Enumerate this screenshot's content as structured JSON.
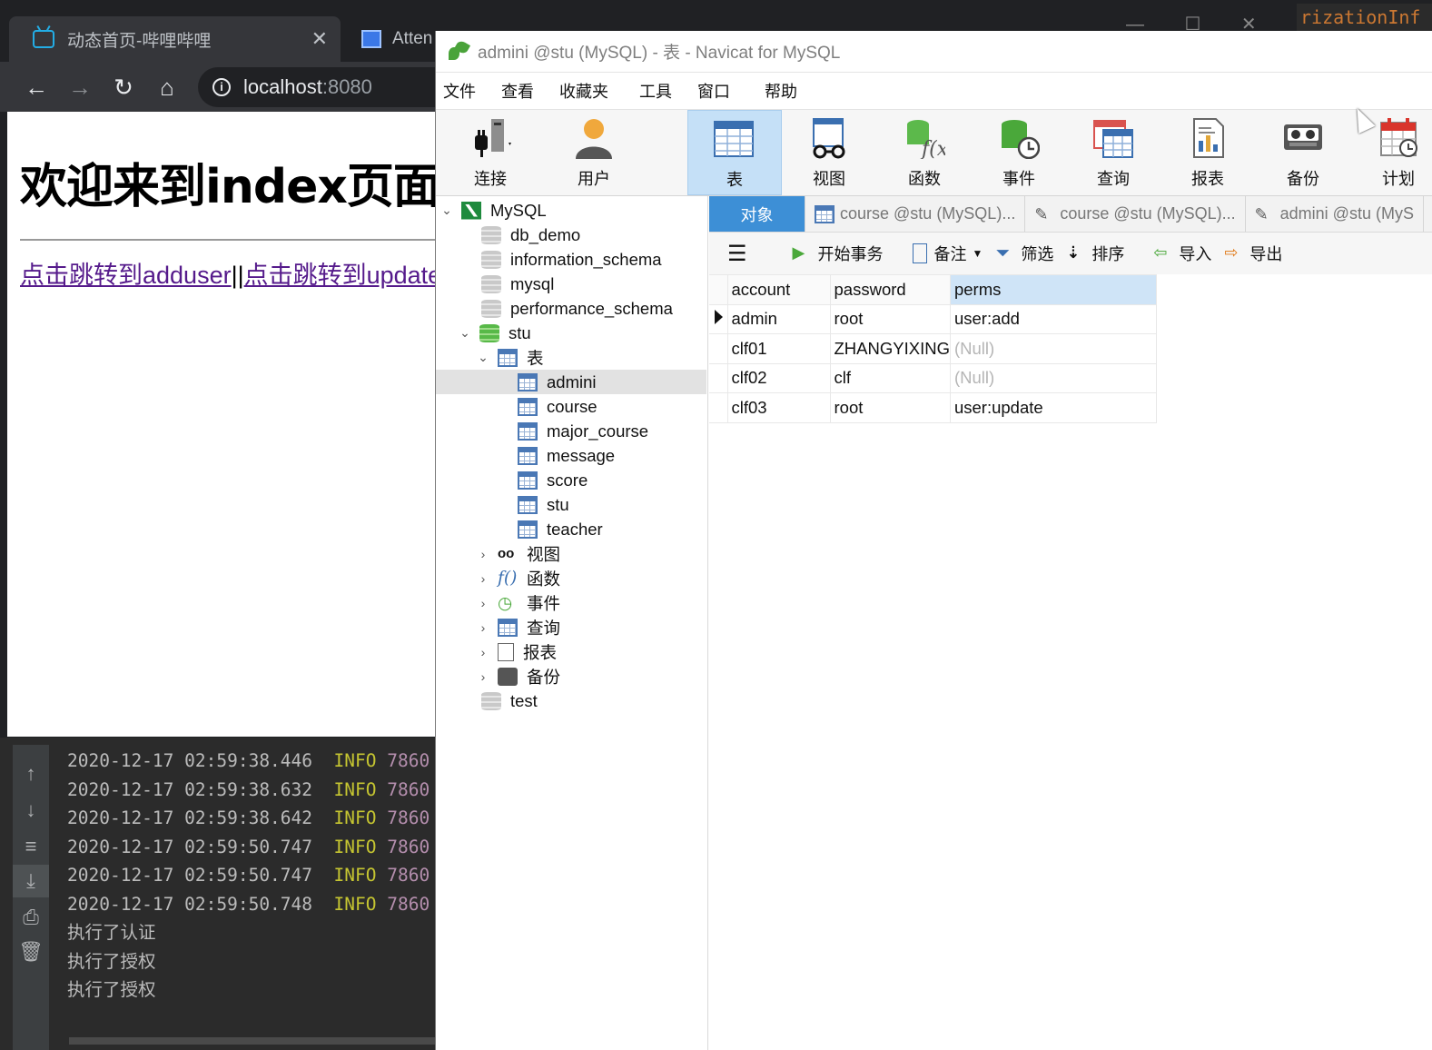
{
  "browser": {
    "tabs": [
      {
        "title": "动态首页-哔哩哔哩",
        "icon": "bilibili-tv-icon",
        "close": "✕"
      },
      {
        "title": "Atten",
        "icon": "document-icon"
      }
    ],
    "url_host": "localhost",
    "url_port": ":8080",
    "page": {
      "heading": "欢迎来到index页面",
      "link_adduser": "点击跳转到adduser",
      "separator": "||",
      "link_update": "点击跳转到update"
    }
  },
  "ide": {
    "code_snippet": "rizationInf",
    "console_logs": [
      {
        "ts": "2020-12-17 02:59:38.446",
        "level": "INFO",
        "pid": "7860"
      },
      {
        "ts": "2020-12-17 02:59:38.632",
        "level": "INFO",
        "pid": "7860"
      },
      {
        "ts": "2020-12-17 02:59:38.642",
        "level": "INFO",
        "pid": "7860"
      },
      {
        "ts": "2020-12-17 02:59:50.747",
        "level": "INFO",
        "pid": "7860"
      },
      {
        "ts": "2020-12-17 02:59:50.747",
        "level": "INFO",
        "pid": "7860"
      },
      {
        "ts": "2020-12-17 02:59:50.748",
        "level": "INFO",
        "pid": "7860"
      }
    ],
    "console_messages": [
      "执行了认证",
      "执行了授权",
      "执行了授权"
    ]
  },
  "navicat": {
    "title": "admini @stu (MySQL) - 表 - Navicat for MySQL",
    "menu": [
      "文件",
      "查看",
      "收藏夹",
      "工具",
      "窗口",
      "帮助"
    ],
    "toolbar": [
      {
        "label": "连接",
        "icon": "connection-plug-icon"
      },
      {
        "label": "用户",
        "icon": "user-icon"
      },
      {
        "label": "表",
        "icon": "table-icon",
        "active": true
      },
      {
        "label": "视图",
        "icon": "view-glasses-icon"
      },
      {
        "label": "函数",
        "icon": "function-icon"
      },
      {
        "label": "事件",
        "icon": "event-clock-icon"
      },
      {
        "label": "查询",
        "icon": "query-icon"
      },
      {
        "label": "报表",
        "icon": "report-icon"
      },
      {
        "label": "备份",
        "icon": "backup-icon"
      },
      {
        "label": "计划",
        "icon": "schedule-calendar-icon"
      }
    ],
    "tree": {
      "connection": "MySQL",
      "databases": [
        "db_demo",
        "information_schema",
        "mysql",
        "performance_schema",
        "stu"
      ],
      "tables_folder": "表",
      "tables": [
        "admini",
        "course",
        "major_course",
        "message",
        "score",
        "stu",
        "teacher"
      ],
      "selected_table": "admini",
      "folders": [
        "视图",
        "函数",
        "事件",
        "查询",
        "报表",
        "备份"
      ],
      "last_db": "test"
    },
    "tabs": [
      {
        "label": "对象",
        "active": true
      },
      {
        "label": "course @stu (MySQL)..."
      },
      {
        "label": "course @stu (MySQL)..."
      },
      {
        "label": "admini @stu (MyS"
      }
    ],
    "object_toolbar": {
      "begin_txn": "开始事务",
      "memo": "备注",
      "filter": "筛选",
      "sort": "排序",
      "import": "导入",
      "export": "导出"
    },
    "grid": {
      "columns": [
        "account",
        "password",
        "perms"
      ],
      "rows": [
        [
          "admin",
          "root",
          "user:add"
        ],
        [
          "clf01",
          "ZHANGYIXING",
          "(Null)"
        ],
        [
          "clf02",
          "clf",
          "(Null)"
        ],
        [
          "clf03",
          "root",
          "user:update"
        ]
      ]
    }
  }
}
